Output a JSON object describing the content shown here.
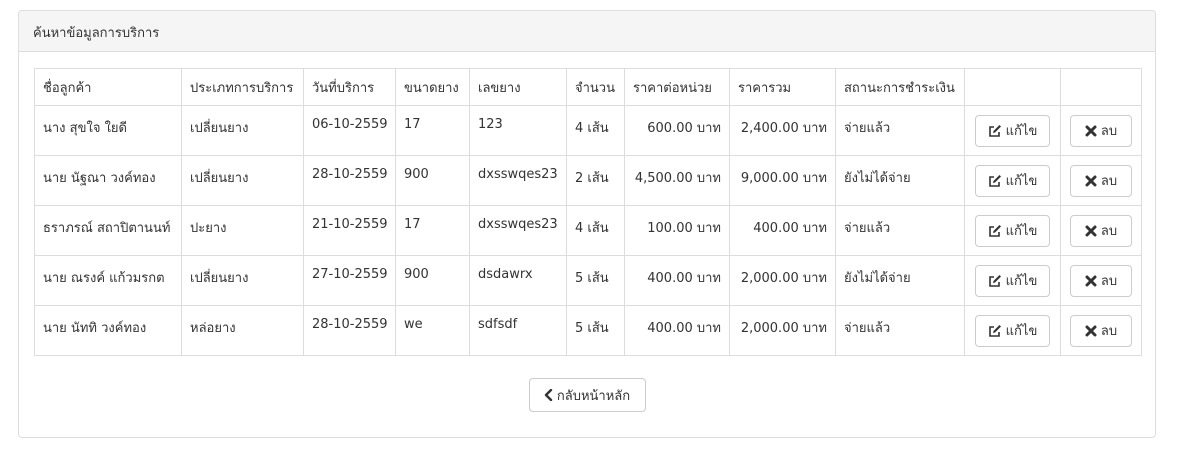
{
  "panel": {
    "title": "ค้นหาข้อมูลการบริการ"
  },
  "table": {
    "headers": [
      "ชื่อลูกค้า",
      "ประเภทการบริการ",
      "วันที่บริการ",
      "ขนาดยาง",
      "เลขยาง",
      "จำนวน",
      "ราคาต่อหน่วย",
      "ราคารวม",
      "สถานะการชำระเงิน",
      "",
      ""
    ],
    "rows": [
      {
        "customer": "นาง สุขใจ ใยดี",
        "service": "เปลี่ยนยาง",
        "date": "06-10-2559",
        "size": "17",
        "tire_no": "123",
        "qty": "4 เส้น",
        "unit_price": "600.00 บาท",
        "total": "2,400.00 บาท",
        "status": "จ่ายแล้ว"
      },
      {
        "customer": "นาย นัฐณา วงค์ทอง",
        "service": "เปลี่ยนยาง",
        "date": "28-10-2559",
        "size": "900",
        "tire_no": "dxsswqes23",
        "qty": "2 เส้น",
        "unit_price": "4,500.00 บาท",
        "total": "9,000.00 บาท",
        "status": "ยังไม่ได้จ่าย"
      },
      {
        "customer": "ธราภรณ์ สถาปิตานนท์",
        "service": "ปะยาง",
        "date": "21-10-2559",
        "size": "17",
        "tire_no": "dxsswqes23",
        "qty": "4 เส้น",
        "unit_price": "100.00 บาท",
        "total": "400.00 บาท",
        "status": "จ่ายแล้ว"
      },
      {
        "customer": "นาย ณรงค์ แก้วมรกต",
        "service": "เปลี่ยนยาง",
        "date": "27-10-2559",
        "size": "900",
        "tire_no": "dsdawrx",
        "qty": "5 เส้น",
        "unit_price": "400.00 บาท",
        "total": "2,000.00 บาท",
        "status": "ยังไม่ได้จ่าย"
      },
      {
        "customer": "นาย นัททิ วงค์ทอง",
        "service": "หล่อยาง",
        "date": "28-10-2559",
        "size": "we",
        "tire_no": "sdfsdf",
        "qty": "5 เส้น",
        "unit_price": "400.00 บาท",
        "total": "2,000.00 บาท",
        "status": "จ่ายแล้ว"
      }
    ],
    "edit_label": "แก้ไข",
    "delete_label": "ลบ"
  },
  "back_button": {
    "label": "กลับหน้าหลัก"
  },
  "icons": {
    "edit": "edit-icon",
    "delete": "x-icon",
    "back": "chevron-left-icon"
  }
}
